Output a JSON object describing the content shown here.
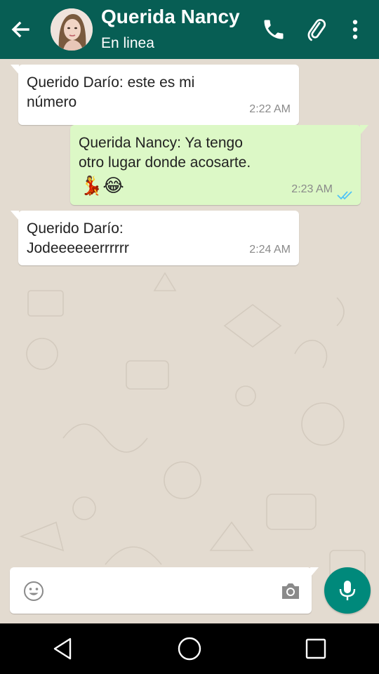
{
  "header": {
    "title": "Querida Nancy",
    "status": "En linea",
    "icons": [
      "back-arrow-icon",
      "avatar",
      "phone-icon",
      "paperclip-icon",
      "more-vert-icon"
    ]
  },
  "colors": {
    "header_bg": "#075e54",
    "chat_bg": "#e3dbd0",
    "outgoing_bubble": "#dcf8c6",
    "incoming_bubble": "#ffffff",
    "read_ticks": "#4fc3f7",
    "mic_button": "#00897b"
  },
  "messages": [
    {
      "direction": "in",
      "text": "Querido Darío: este es mi\nnúmero",
      "time": "2:22 AM"
    },
    {
      "direction": "out",
      "text": "Querida Nancy: Ya tengo\notro lugar donde acosarte.",
      "emojis": "💃😂",
      "time": "2:23 AM",
      "status": "read"
    },
    {
      "direction": "in",
      "text": "Querido Darío:\nJodeeeeeerrrrrr",
      "time": "2:24 AM"
    }
  ],
  "composer": {
    "placeholder": "",
    "icons": [
      "emoji-icon",
      "camera-icon",
      "mic-icon"
    ]
  },
  "system_nav": [
    "back-triangle-icon",
    "home-circle-icon",
    "recents-square-icon"
  ]
}
